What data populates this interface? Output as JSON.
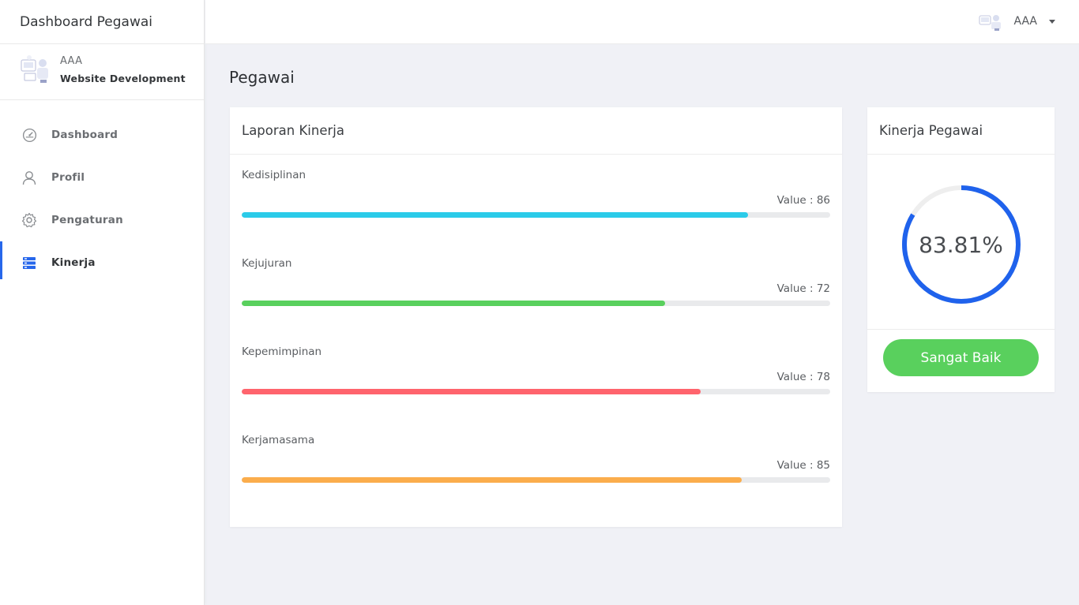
{
  "app": {
    "brand": "Dashboard Pegawai"
  },
  "user": {
    "name": "AAA",
    "role": "Website Development"
  },
  "sidebar": {
    "items": [
      {
        "label": "Dashboard",
        "icon": "dashboard-gauge-icon",
        "active": false
      },
      {
        "label": "Profil",
        "icon": "user-icon",
        "active": false
      },
      {
        "label": "Pengaturan",
        "icon": "gear-icon",
        "active": false
      },
      {
        "label": "Kinerja",
        "icon": "server-list-icon",
        "active": true
      }
    ]
  },
  "topbar": {
    "user_name": "AAA",
    "caret_icon": "caret-down-icon"
  },
  "page": {
    "title": "Pegawai"
  },
  "report": {
    "title": "Laporan Kinerja",
    "metrics": [
      {
        "label": "Kedisiplinan",
        "value_text": "Value : 86",
        "value": 86,
        "color": "#2bcbe9"
      },
      {
        "label": "Kejujuran",
        "value_text": "Value : 72",
        "value": 72,
        "color": "#59d05d"
      },
      {
        "label": "Kepemimpinan",
        "value_text": "Value : 78",
        "value": 78,
        "color": "#ff646d"
      },
      {
        "label": "Kerjamasama",
        "value_text": "Value : 85",
        "value": 85,
        "color": "#fbad4c"
      }
    ]
  },
  "performance": {
    "title": "Kinerja Pegawai",
    "percent_text": "83.81%",
    "percent": 83.81,
    "ring_color": "#1f62ec",
    "status_label": "Sangat Baik",
    "status_color": "#59d05d"
  }
}
